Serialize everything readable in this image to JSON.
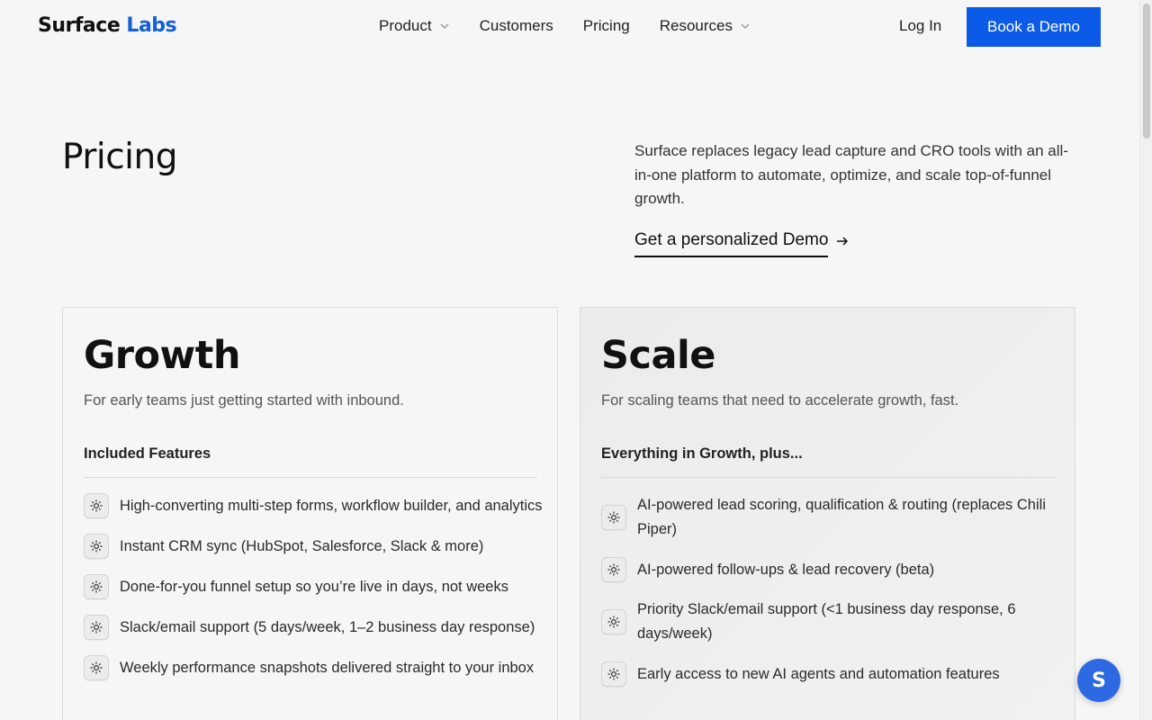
{
  "header": {
    "logo_part1": "Surface",
    "logo_part2": "Labs",
    "nav": {
      "product": "Product",
      "customers": "Customers",
      "pricing": "Pricing",
      "resources": "Resources"
    },
    "login": "Log In",
    "book_demo": "Book a Demo"
  },
  "hero": {
    "title": "Pricing",
    "intro": "Surface replaces legacy lead capture and CRO tools with an all-in-one platform to automate, optimize, and scale top-of-funnel growth.",
    "cta": "Get a personalized Demo"
  },
  "plans": [
    {
      "name": "Growth",
      "description": "For early teams just getting started with inbound.",
      "features_heading": "Included Features",
      "features": [
        "High-converting multi-step forms, workflow builder, and analytics",
        "Instant CRM sync (HubSpot, Salesforce, Slack & more)",
        "Done-for-you funnel setup so you’re live in days, not weeks",
        "Slack/email support (5 days/week, 1–2 business day response)",
        "Weekly performance snapshots delivered straight to your inbox"
      ]
    },
    {
      "name": "Scale",
      "description": "For scaling teams that need to accelerate growth, fast.",
      "features_heading": "Everything in Growth, plus...",
      "features": [
        "AI-powered lead scoring, qualification & routing (replaces Chili Piper)",
        "AI-powered follow-ups & lead recovery (beta)",
        "Priority Slack/email support (<1 business day response, 6 days/week)",
        "Early access to new AI agents and automation features"
      ]
    }
  ],
  "chat": {
    "label": "S"
  },
  "colors": {
    "brand_blue": "#0b5be8",
    "logo_accent": "#1560d6",
    "chat_blue": "#2e69e4",
    "background": "#f6f6f6"
  },
  "icons": {
    "nav_dropdown": "chevron-down-icon",
    "cta": "arrow-right-icon",
    "feature": "sparkle-burst-icon"
  }
}
